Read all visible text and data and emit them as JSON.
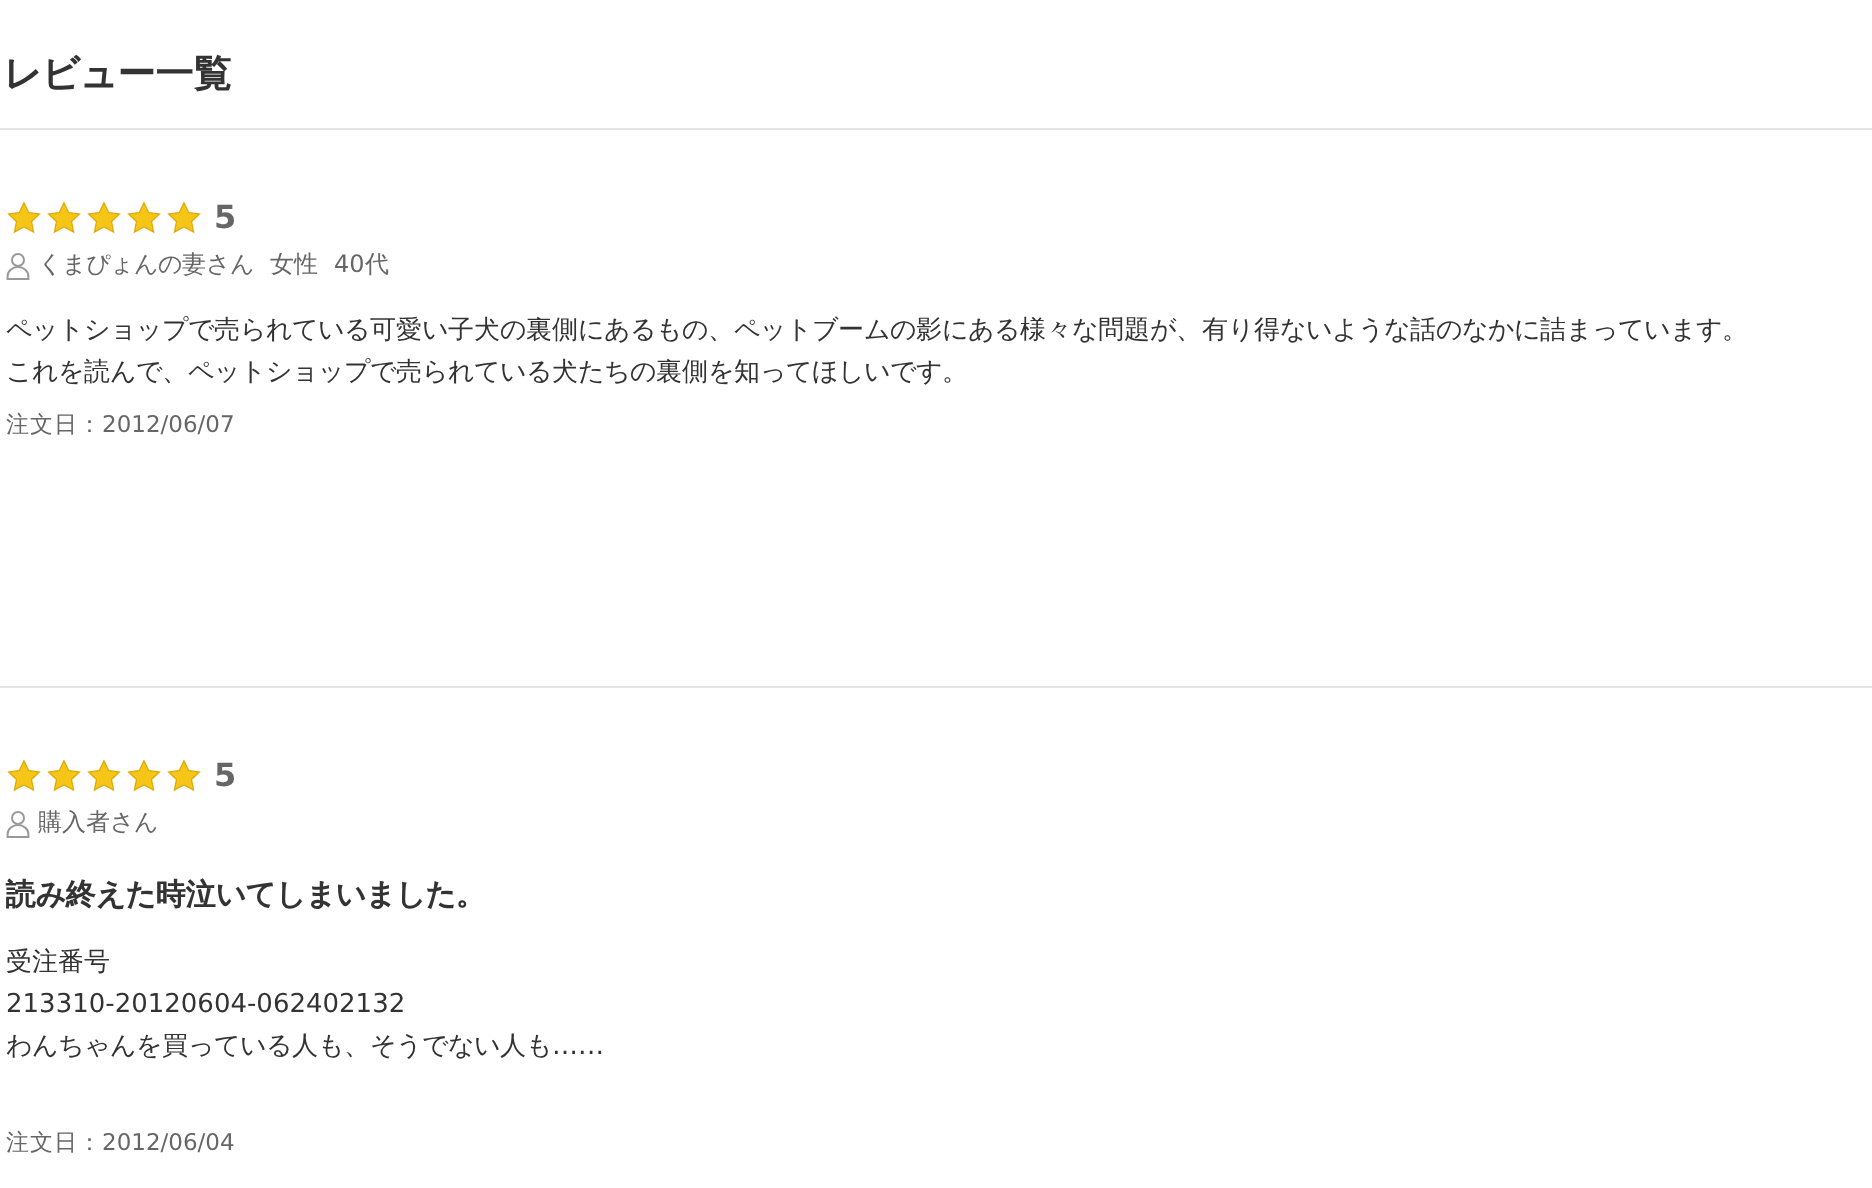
{
  "heading": "レビュー一覧",
  "reviews": [
    {
      "stars": 5,
      "rating": "5",
      "reviewer": [
        "くまぴょんの妻さん",
        "女性",
        "40代"
      ],
      "body": [
        "ペットショップで売られている可愛い子犬の裏側にあるもの、ペットブームの影にある様々な問題が、有り得ないような話のなかに詰まっています。",
        "これを読んで、ペットショップで売られている犬たちの裏側を知ってほしいです。"
      ],
      "date": "注文日：2012/06/07"
    },
    {
      "stars": 5,
      "rating": "5",
      "reviewer": [
        "購入者さん"
      ],
      "title": "読み終えた時泣いてしまいました。",
      "body": [
        "受注番号",
        "213310-20120604-062402132",
        "わんちゃんを買っている人も、そうでない人も‥‥‥"
      ],
      "date": "注文日：2012/06/04"
    }
  ]
}
